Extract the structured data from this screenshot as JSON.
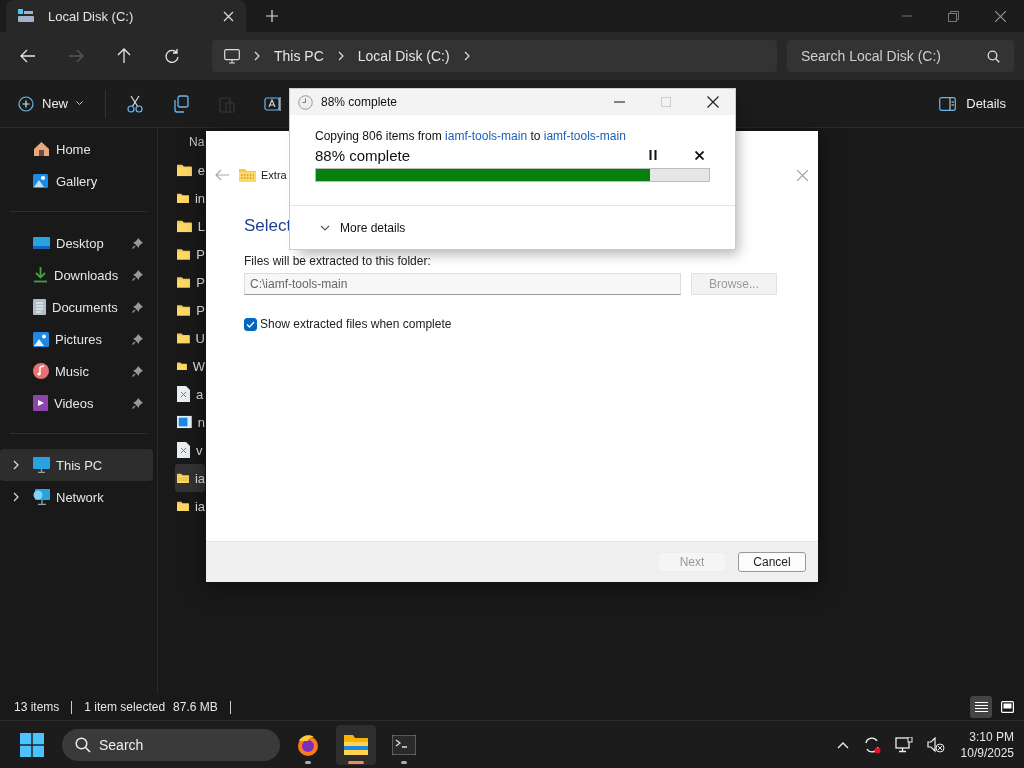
{
  "explorer": {
    "tab": {
      "title": "Local Disk (C:)",
      "selected": true
    },
    "nav_buttons": [
      {
        "kind": "back",
        "disabled": false
      },
      {
        "kind": "forward",
        "disabled": true
      },
      {
        "kind": "up",
        "disabled": false
      },
      {
        "kind": "refresh",
        "disabled": false
      }
    ],
    "breadcrumb": [
      "This PC",
      "Local Disk (C:)"
    ],
    "search": {
      "placeholder": "Search Local Disk (C:)"
    },
    "new_label": "New",
    "commands": [
      {
        "kind": "cut",
        "disabled": false
      },
      {
        "kind": "copy",
        "disabled": false
      },
      {
        "kind": "paste",
        "disabled": true
      },
      {
        "kind": "rename",
        "disabled": false
      }
    ],
    "details_label": "Details",
    "sidebar": [
      [
        {
          "label": "Home",
          "kind": "home",
          "pinned": false,
          "selected": false
        },
        {
          "label": "Gallery",
          "kind": "gallery",
          "pinned": false,
          "selected": false
        }
      ],
      [
        {
          "label": "Desktop",
          "kind": "desktop",
          "pinned": true,
          "selected": false
        },
        {
          "label": "Downloads",
          "kind": "downloads",
          "pinned": true,
          "selected": false
        },
        {
          "label": "Documents",
          "kind": "documents",
          "pinned": true,
          "selected": false
        },
        {
          "label": "Pictures",
          "kind": "pictures",
          "pinned": true,
          "selected": false
        },
        {
          "label": "Music",
          "kind": "music",
          "pinned": true,
          "selected": false
        },
        {
          "label": "Videos",
          "kind": "videos",
          "pinned": true,
          "selected": false
        }
      ],
      [
        {
          "label": "This PC",
          "kind": "thispc",
          "pinned": false,
          "selected": true,
          "expanded": false
        },
        {
          "label": "Network",
          "kind": "network",
          "pinned": false,
          "selected": false,
          "expanded": false
        }
      ]
    ],
    "column_header": "Na",
    "files": [
      {
        "name": "e",
        "kind": "folder",
        "selected": false
      },
      {
        "name": "in",
        "kind": "folder",
        "selected": false
      },
      {
        "name": "L",
        "kind": "folder",
        "selected": false
      },
      {
        "name": "P",
        "kind": "folder",
        "selected": false
      },
      {
        "name": "P",
        "kind": "folder",
        "selected": false
      },
      {
        "name": "P",
        "kind": "folder",
        "selected": false
      },
      {
        "name": "U",
        "kind": "folder",
        "selected": false
      },
      {
        "name": "W",
        "kind": "folder",
        "selected": false
      },
      {
        "name": "a",
        "kind": "file",
        "selected": false
      },
      {
        "name": "n",
        "kind": "image",
        "selected": false
      },
      {
        "name": "v",
        "kind": "file",
        "selected": false
      },
      {
        "name": "ia",
        "kind": "zip",
        "selected": true
      },
      {
        "name": "ia",
        "kind": "folder",
        "selected": false
      }
    ],
    "status_bar": {
      "count": "13 items",
      "selection": "1 item selected",
      "size": "87.6 MB"
    },
    "views": [
      {
        "kind": "details",
        "selected": true
      },
      {
        "kind": "tiles",
        "selected": false
      }
    ]
  },
  "extract_dialog": {
    "title": "Extra",
    "heading": "Select",
    "folder_label": "Files will be extracted to this folder:",
    "path": "C:\\iamf-tools-main",
    "browse": {
      "label": "Browse...",
      "disabled": true
    },
    "show_files": {
      "label": "Show extracted files when complete",
      "checked": true
    },
    "next": {
      "label": "Next",
      "disabled": true
    },
    "cancel": {
      "label": "Cancel",
      "disabled": false
    }
  },
  "progress_dialog": {
    "title": "88% complete",
    "prefix": "Copying 806 items from",
    "source": "iamf-tools-main",
    "middle": "to",
    "destination": "iamf-tools-main",
    "status": "88% complete",
    "level": 0.85,
    "paused": false,
    "more_details": {
      "label": "More details",
      "expanded": false
    },
    "maximize_disabled": true
  },
  "taskbar": {
    "search_placeholder": "Search",
    "apps": [
      {
        "kind": "firefox",
        "active": false,
        "running": true
      },
      {
        "kind": "explorer",
        "active": true,
        "running": true
      },
      {
        "kind": "terminal",
        "active": false,
        "running": true
      }
    ],
    "time": "3:10 PM",
    "date": "10/9/2025"
  }
}
